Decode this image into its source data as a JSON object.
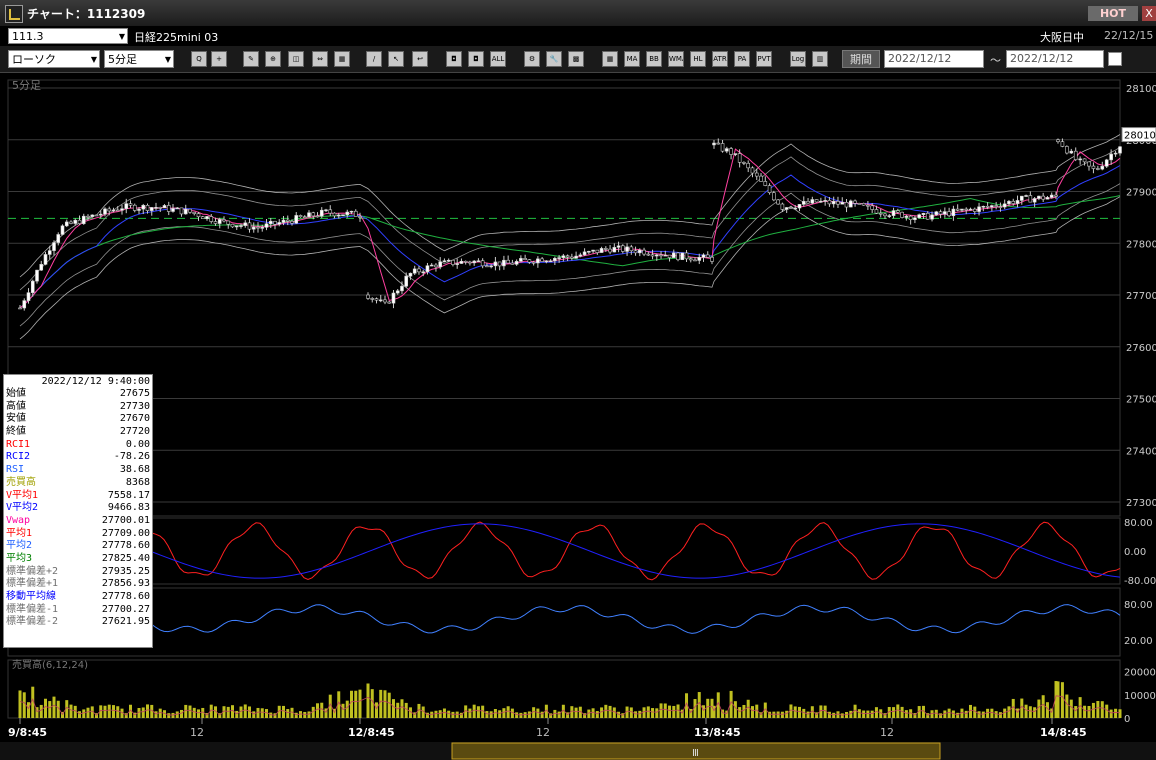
{
  "window": {
    "title": "チャート：1112309",
    "hot_label": "HOT",
    "close_label": "X"
  },
  "symbol_bar": {
    "code": "111.3",
    "name": "日経225mini 03",
    "market": "大阪日中",
    "date": "22/12/15"
  },
  "toolbar": {
    "chart_type": "ローソク",
    "interval": "5分足",
    "buttons": [
      {
        "name": "zoom-tool",
        "label": "Q"
      },
      {
        "name": "crosshair-tool",
        "label": "+"
      },
      {
        "name": "draw-tool-1",
        "label": "✎"
      },
      {
        "name": "draw-tool-2",
        "label": "⊕"
      },
      {
        "name": "draw-tool-3",
        "label": "◫"
      },
      {
        "name": "draw-tool-4",
        "label": "⇔"
      },
      {
        "name": "draw-tool-5",
        "label": "▦"
      },
      {
        "name": "line-tool",
        "label": "/"
      },
      {
        "name": "cursor-tool",
        "label": "↖"
      },
      {
        "name": "arrow-tool",
        "label": "↩"
      },
      {
        "name": "candle-view-1",
        "label": "◘"
      },
      {
        "name": "candle-view-2",
        "label": "◘"
      },
      {
        "name": "all-view",
        "label": "ALL"
      },
      {
        "name": "settings-tool",
        "label": "⚙"
      },
      {
        "name": "wrench-tool",
        "label": "🔧"
      },
      {
        "name": "palette-tool",
        "label": "▩"
      },
      {
        "name": "ind-grid",
        "label": "▦"
      },
      {
        "name": "ind-ma",
        "label": "MA"
      },
      {
        "name": "ind-bb",
        "label": "BB"
      },
      {
        "name": "ind-wma",
        "label": "WMA"
      },
      {
        "name": "ind-hl",
        "label": "HL"
      },
      {
        "name": "ind-atr",
        "label": "ATR"
      },
      {
        "name": "ind-pa",
        "label": "PA"
      },
      {
        "name": "ind-pvt",
        "label": "PVT"
      },
      {
        "name": "ind-log",
        "label": "Log"
      },
      {
        "name": "ind-split",
        "label": "▥"
      }
    ],
    "period_label": "期間",
    "date_from": "2022/12/12",
    "date_to": "2022/12/12",
    "tilde": "～"
  },
  "colors": {
    "up_candle": "#ffffff",
    "down_candle": "#000000",
    "ma_short": "#ff3fa0",
    "ma_mid": "#3040ff",
    "ma_long": "#20b040",
    "bollinger": "#a0a0a0",
    "rci1": "#ff2020",
    "rci2": "#2020ff",
    "rsi": "#4080ff",
    "volume": "#c0c020",
    "dashed_level": "#20c040"
  },
  "chart_data": {
    "type": "candlestick",
    "panel_label": "5分足",
    "price_axis_ticks": [
      28100,
      28000,
      27900,
      27800,
      27700,
      27600,
      27500,
      27400,
      27300
    ],
    "price_range": [
      27300,
      28100
    ],
    "current_price_label": "28010",
    "dashed_level": 27848,
    "x_tick_labels": [
      "9/8:45",
      "12",
      "12/8:45",
      "12",
      "13/8:45",
      "12",
      "14/8:45"
    ],
    "sessions": [
      {
        "label": "9/8:45",
        "open": 27660,
        "points": [
          [
            0,
            27675
          ],
          [
            0.06,
            27760
          ],
          [
            0.12,
            27830
          ],
          [
            0.2,
            27850
          ],
          [
            0.3,
            27870
          ],
          [
            0.4,
            27870
          ],
          [
            0.5,
            27860
          ],
          [
            0.6,
            27840
          ],
          [
            0.7,
            27830
          ],
          [
            0.8,
            27845
          ],
          [
            0.9,
            27860
          ],
          [
            1,
            27855
          ]
        ]
      },
      {
        "label": "12/8:45",
        "points": [
          [
            0,
            27700
          ],
          [
            0.05,
            27680
          ],
          [
            0.12,
            27740
          ],
          [
            0.2,
            27760
          ],
          [
            0.3,
            27765
          ],
          [
            0.4,
            27760
          ],
          [
            0.5,
            27770
          ],
          [
            0.6,
            27775
          ],
          [
            0.7,
            27790
          ],
          [
            0.8,
            27785
          ],
          [
            0.9,
            27775
          ],
          [
            1,
            27770
          ]
        ]
      },
      {
        "label": "13/8:45",
        "points": [
          [
            0,
            27990
          ],
          [
            0.05,
            27975
          ],
          [
            0.12,
            27930
          ],
          [
            0.2,
            27870
          ],
          [
            0.3,
            27880
          ],
          [
            0.4,
            27875
          ],
          [
            0.5,
            27860
          ],
          [
            0.6,
            27850
          ],
          [
            0.7,
            27860
          ],
          [
            0.8,
            27870
          ],
          [
            0.9,
            27885
          ],
          [
            1,
            27890
          ]
        ]
      },
      {
        "label": "14/8:45",
        "points": [
          [
            0,
            28000
          ],
          [
            0.3,
            27960
          ],
          [
            0.6,
            27940
          ],
          [
            1,
            27990
          ]
        ]
      }
    ],
    "rci_axis_ticks": [
      "80.00",
      "0.00",
      "-80.00"
    ],
    "rsi_axis_ticks": [
      "80.00",
      "20.00"
    ],
    "volume_axis_ticks": [
      "20000",
      "10000",
      "0"
    ],
    "volume_label": "売買高(6,12,24)"
  },
  "info_panel": {
    "datetime": "2022/12/12  9:40:00",
    "rows": [
      {
        "k": "始値",
        "v": "27675",
        "c": "#000000"
      },
      {
        "k": "高値",
        "v": "27730",
        "c": "#000000"
      },
      {
        "k": "安値",
        "v": "27670",
        "c": "#000000"
      },
      {
        "k": "終値",
        "v": "27720",
        "c": "#000000"
      },
      {
        "k": "RCI1",
        "v": "0.00",
        "c": "#ff0000"
      },
      {
        "k": "RCI2",
        "v": "-78.26",
        "c": "#0000ff"
      },
      {
        "k": "RSI",
        "v": "38.68",
        "c": "#2060ff"
      },
      {
        "k": "売買高",
        "v": "8368",
        "c": "#a0a000"
      },
      {
        "k": "V平均1",
        "v": "7558.17",
        "c": "#ff0000"
      },
      {
        "k": "V平均2",
        "v": "9466.83",
        "c": "#0000ff"
      },
      {
        "k": "Vwap",
        "v": "27700.01",
        "c": "#ff00a0"
      },
      {
        "k": "平均1",
        "v": "27709.00",
        "c": "#ff0000"
      },
      {
        "k": "平均2",
        "v": "27778.60",
        "c": "#2060ff"
      },
      {
        "k": "平均3",
        "v": "27825.40",
        "c": "#008000"
      },
      {
        "k": "標準偏差+2",
        "v": "27935.25",
        "c": "#707070"
      },
      {
        "k": "標準偏差+1",
        "v": "27856.93",
        "c": "#707070"
      },
      {
        "k": "移動平均線",
        "v": "27778.60",
        "c": "#0000ff"
      },
      {
        "k": "標準偏差-1",
        "v": "27700.27",
        "c": "#707070"
      },
      {
        "k": "標準偏差-2",
        "v": "27621.95",
        "c": "#707070"
      }
    ]
  }
}
